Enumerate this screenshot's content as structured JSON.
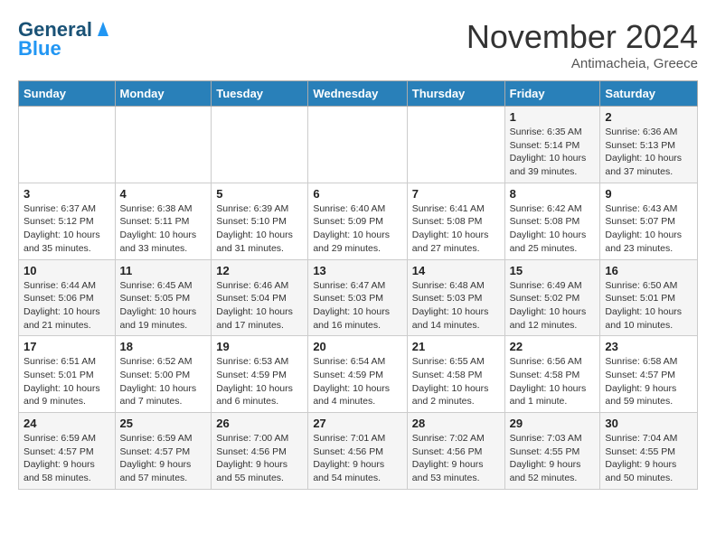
{
  "header": {
    "logo_line1": "General",
    "logo_line2": "Blue",
    "month": "November 2024",
    "location": "Antimacheia, Greece"
  },
  "days_of_week": [
    "Sunday",
    "Monday",
    "Tuesday",
    "Wednesday",
    "Thursday",
    "Friday",
    "Saturday"
  ],
  "weeks": [
    [
      {
        "day": "",
        "text": ""
      },
      {
        "day": "",
        "text": ""
      },
      {
        "day": "",
        "text": ""
      },
      {
        "day": "",
        "text": ""
      },
      {
        "day": "",
        "text": ""
      },
      {
        "day": "1",
        "text": "Sunrise: 6:35 AM\nSunset: 5:14 PM\nDaylight: 10 hours and 39 minutes."
      },
      {
        "day": "2",
        "text": "Sunrise: 6:36 AM\nSunset: 5:13 PM\nDaylight: 10 hours and 37 minutes."
      }
    ],
    [
      {
        "day": "3",
        "text": "Sunrise: 6:37 AM\nSunset: 5:12 PM\nDaylight: 10 hours and 35 minutes."
      },
      {
        "day": "4",
        "text": "Sunrise: 6:38 AM\nSunset: 5:11 PM\nDaylight: 10 hours and 33 minutes."
      },
      {
        "day": "5",
        "text": "Sunrise: 6:39 AM\nSunset: 5:10 PM\nDaylight: 10 hours and 31 minutes."
      },
      {
        "day": "6",
        "text": "Sunrise: 6:40 AM\nSunset: 5:09 PM\nDaylight: 10 hours and 29 minutes."
      },
      {
        "day": "7",
        "text": "Sunrise: 6:41 AM\nSunset: 5:08 PM\nDaylight: 10 hours and 27 minutes."
      },
      {
        "day": "8",
        "text": "Sunrise: 6:42 AM\nSunset: 5:08 PM\nDaylight: 10 hours and 25 minutes."
      },
      {
        "day": "9",
        "text": "Sunrise: 6:43 AM\nSunset: 5:07 PM\nDaylight: 10 hours and 23 minutes."
      }
    ],
    [
      {
        "day": "10",
        "text": "Sunrise: 6:44 AM\nSunset: 5:06 PM\nDaylight: 10 hours and 21 minutes."
      },
      {
        "day": "11",
        "text": "Sunrise: 6:45 AM\nSunset: 5:05 PM\nDaylight: 10 hours and 19 minutes."
      },
      {
        "day": "12",
        "text": "Sunrise: 6:46 AM\nSunset: 5:04 PM\nDaylight: 10 hours and 17 minutes."
      },
      {
        "day": "13",
        "text": "Sunrise: 6:47 AM\nSunset: 5:03 PM\nDaylight: 10 hours and 16 minutes."
      },
      {
        "day": "14",
        "text": "Sunrise: 6:48 AM\nSunset: 5:03 PM\nDaylight: 10 hours and 14 minutes."
      },
      {
        "day": "15",
        "text": "Sunrise: 6:49 AM\nSunset: 5:02 PM\nDaylight: 10 hours and 12 minutes."
      },
      {
        "day": "16",
        "text": "Sunrise: 6:50 AM\nSunset: 5:01 PM\nDaylight: 10 hours and 10 minutes."
      }
    ],
    [
      {
        "day": "17",
        "text": "Sunrise: 6:51 AM\nSunset: 5:01 PM\nDaylight: 10 hours and 9 minutes."
      },
      {
        "day": "18",
        "text": "Sunrise: 6:52 AM\nSunset: 5:00 PM\nDaylight: 10 hours and 7 minutes."
      },
      {
        "day": "19",
        "text": "Sunrise: 6:53 AM\nSunset: 4:59 PM\nDaylight: 10 hours and 6 minutes."
      },
      {
        "day": "20",
        "text": "Sunrise: 6:54 AM\nSunset: 4:59 PM\nDaylight: 10 hours and 4 minutes."
      },
      {
        "day": "21",
        "text": "Sunrise: 6:55 AM\nSunset: 4:58 PM\nDaylight: 10 hours and 2 minutes."
      },
      {
        "day": "22",
        "text": "Sunrise: 6:56 AM\nSunset: 4:58 PM\nDaylight: 10 hours and 1 minute."
      },
      {
        "day": "23",
        "text": "Sunrise: 6:58 AM\nSunset: 4:57 PM\nDaylight: 9 hours and 59 minutes."
      }
    ],
    [
      {
        "day": "24",
        "text": "Sunrise: 6:59 AM\nSunset: 4:57 PM\nDaylight: 9 hours and 58 minutes."
      },
      {
        "day": "25",
        "text": "Sunrise: 6:59 AM\nSunset: 4:57 PM\nDaylight: 9 hours and 57 minutes."
      },
      {
        "day": "26",
        "text": "Sunrise: 7:00 AM\nSunset: 4:56 PM\nDaylight: 9 hours and 55 minutes."
      },
      {
        "day": "27",
        "text": "Sunrise: 7:01 AM\nSunset: 4:56 PM\nDaylight: 9 hours and 54 minutes."
      },
      {
        "day": "28",
        "text": "Sunrise: 7:02 AM\nSunset: 4:56 PM\nDaylight: 9 hours and 53 minutes."
      },
      {
        "day": "29",
        "text": "Sunrise: 7:03 AM\nSunset: 4:55 PM\nDaylight: 9 hours and 52 minutes."
      },
      {
        "day": "30",
        "text": "Sunrise: 7:04 AM\nSunset: 4:55 PM\nDaylight: 9 hours and 50 minutes."
      }
    ]
  ]
}
